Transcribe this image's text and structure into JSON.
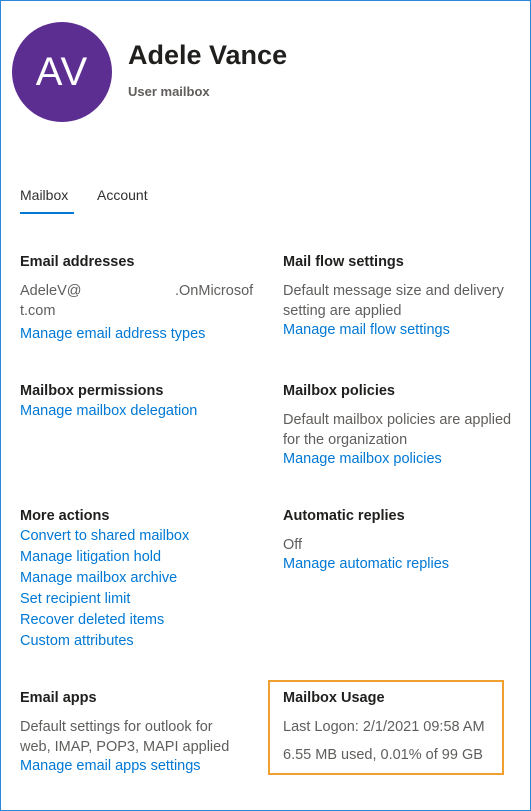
{
  "profile": {
    "initials": "AV",
    "name": "Adele Vance",
    "type": "User mailbox",
    "avatar_color": "#5c2e91"
  },
  "tabs": [
    {
      "label": "Mailbox",
      "active": true
    },
    {
      "label": "Account",
      "active": false
    }
  ],
  "email_addresses": {
    "heading": "Email addresses",
    "address_line1_a": "AdeleV@",
    "address_line1_b": ".OnMicrosof",
    "address_line2": "t.com",
    "link": "Manage email address types"
  },
  "mail_flow": {
    "heading": "Mail flow settings",
    "desc_line1": "Default message size and delivery",
    "desc_line2": "setting are applied",
    "link": "Manage mail flow settings"
  },
  "permissions": {
    "heading": "Mailbox permissions",
    "link": "Manage mailbox delegation"
  },
  "policies": {
    "heading": "Mailbox policies",
    "desc_line1": "Default mailbox policies are applied",
    "desc_line2": "for the organization",
    "link": "Manage mailbox policies"
  },
  "more_actions": {
    "heading": "More actions",
    "links": [
      "Convert to shared mailbox",
      "Manage litigation hold",
      "Manage mailbox archive",
      "Set recipient limit",
      "Recover deleted items",
      "Custom attributes"
    ]
  },
  "auto_replies": {
    "heading": "Automatic replies",
    "status": "Off",
    "link": "Manage automatic replies"
  },
  "email_apps": {
    "heading": "Email apps",
    "desc_line1": "Default settings for outlook for",
    "desc_line2": "web, IMAP, POP3, MAPI applied",
    "link": "Manage email apps settings"
  },
  "usage": {
    "heading": "Mailbox Usage",
    "last_logon": "Last Logon: 2/1/2021 09:58 AM",
    "usage": "6.55 MB used, 0.01% of 99 GB",
    "highlight_color": "#f0a030"
  }
}
